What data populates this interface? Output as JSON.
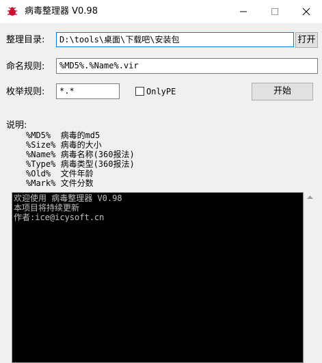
{
  "window": {
    "title": "病毒整理器 V0.98",
    "icon": "virus-icon",
    "controls": [
      "minimize-icon",
      "maximize-icon",
      "close-icon"
    ]
  },
  "form": {
    "dir_label": "整理目录:",
    "dir_value": "D:\\tools\\桌面\\下载吧\\安装包",
    "open_button": "打开",
    "naming_label": "命名规则:",
    "naming_value": "%MD5%.%Name%.vir",
    "enum_label": "枚举规则:",
    "enum_value": "*.*",
    "onlype_label": "OnlyPE",
    "onlype_checked": false,
    "start_button": "开始"
  },
  "description": {
    "header": "说明:",
    "lines": [
      "%MD5%  病毒的md5",
      "%Size% 病毒的大小",
      "%Name% 病毒名称(360报法)",
      "%Type% 病毒类型(360报法)",
      "%Old%  文件年龄",
      "%Mark% 文件分数"
    ]
  },
  "console": {
    "lines": [
      "欢迎使用 病毒整理器 V0.98",
      "本项目将持续更新",
      "作者:ice@icysoft.cn"
    ]
  },
  "colors": {
    "accent": "#0078d7",
    "console_bg": "#000000",
    "console_text": "#c0c0c0",
    "window_bg": "#f0f0f0"
  }
}
